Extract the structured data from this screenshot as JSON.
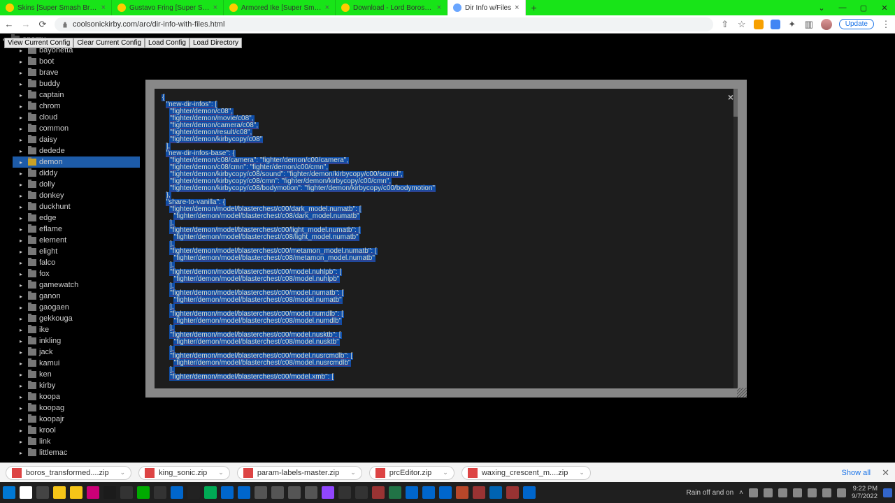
{
  "browser": {
    "tabs": [
      {
        "label": "Skins [Super Smash Bros. Ultim"
      },
      {
        "label": "Gustavo Fring [Super Smash Bro"
      },
      {
        "label": "Armored Ike [Super Smash Bros"
      },
      {
        "label": "Download - Lord Boros - Transfo"
      },
      {
        "label": "Dir Info w/Files"
      }
    ],
    "active_tab": 4,
    "url": "coolsonickirby.com/arc/dir-info-with-files.html",
    "update_label": "Update"
  },
  "toolbar": {
    "buttons": [
      "View Current Config",
      "Clear Current Config",
      "Load Config",
      "Load Directory"
    ]
  },
  "tree": {
    "top_clipped": "enemy",
    "items": [
      "bayonetta",
      "boot",
      "brave",
      "buddy",
      "captain",
      "chrom",
      "cloud",
      "common",
      "daisy",
      "dedede",
      "demon",
      "diddy",
      "dolly",
      "donkey",
      "duckhunt",
      "edge",
      "eflame",
      "element",
      "elight",
      "falco",
      "fox",
      "gamewatch",
      "ganon",
      "gaogaen",
      "gekkouga",
      "ike",
      "inkling",
      "jack",
      "kamui",
      "ken",
      "kirby",
      "koopa",
      "koopag",
      "koopajr",
      "krool",
      "link",
      "littlemac"
    ],
    "selected": "demon"
  },
  "modal": {
    "lines": [
      "{",
      "  \"new-dir-infos\": [",
      "    \"fighter/demon/c08\",",
      "    \"fighter/demon/movie/c08\",",
      "    \"fighter/demon/camera/c08\",",
      "    \"fighter/demon/result/c08\",",
      "    \"fighter/demon/kirbycopy/c08\"",
      "  ],",
      "  \"new-dir-infos-base\": {",
      "    \"fighter/demon/c08/camera\": \"fighter/demon/c00/camera\",",
      "    \"fighter/demon/c08/cmn\": \"fighter/demon/c00/cmn\",",
      "    \"fighter/demon/kirbycopy/c08/sound\": \"fighter/demon/kirbycopy/c00/sound\",",
      "    \"fighter/demon/kirbycopy/c08/cmn\": \"fighter/demon/kirbycopy/c00/cmn\",",
      "    \"fighter/demon/kirbycopy/c08/bodymotion\": \"fighter/demon/kirbycopy/c00/bodymotion\"",
      "  },",
      "  \"share-to-vanilla\": {",
      "    \"fighter/demon/model/blasterchest/c00/dark_model.numatb\": [",
      "      \"fighter/demon/model/blasterchest/c08/dark_model.numatb\"",
      "    ],",
      "    \"fighter/demon/model/blasterchest/c00/light_model.numatb\": [",
      "      \"fighter/demon/model/blasterchest/c08/light_model.numatb\"",
      "    ],",
      "    \"fighter/demon/model/blasterchest/c00/metamon_model.numatb\": [",
      "      \"fighter/demon/model/blasterchest/c08/metamon_model.numatb\"",
      "    ],",
      "    \"fighter/demon/model/blasterchest/c00/model.nuhlpb\": [",
      "      \"fighter/demon/model/blasterchest/c08/model.nuhlpb\"",
      "    ],",
      "    \"fighter/demon/model/blasterchest/c00/model.numatb\": [",
      "      \"fighter/demon/model/blasterchest/c08/model.numatb\"",
      "    ],",
      "    \"fighter/demon/model/blasterchest/c00/model.numdlb\": [",
      "      \"fighter/demon/model/blasterchest/c08/model.numdlb\"",
      "    ],",
      "    \"fighter/demon/model/blasterchest/c00/model.nusktb\": [",
      "      \"fighter/demon/model/blasterchest/c08/model.nusktb\"",
      "    ],",
      "    \"fighter/demon/model/blasterchest/c00/model.nusrcmdlb\": [",
      "      \"fighter/demon/model/blasterchest/c08/model.nusrcmdlb\"",
      "    ],",
      "    \"fighter/demon/model/blasterchest/c00/model.xmb\": ["
    ]
  },
  "downloads": {
    "items": [
      "boros_transformed....zip",
      "king_sonic.zip",
      "param-labels-master.zip",
      "prcEditor.zip",
      "waxing_crescent_m....zip"
    ],
    "show_all": "Show all"
  },
  "tray": {
    "weather": "Rain off and on",
    "time": "9:22 PM",
    "date": "9/7/2022"
  }
}
